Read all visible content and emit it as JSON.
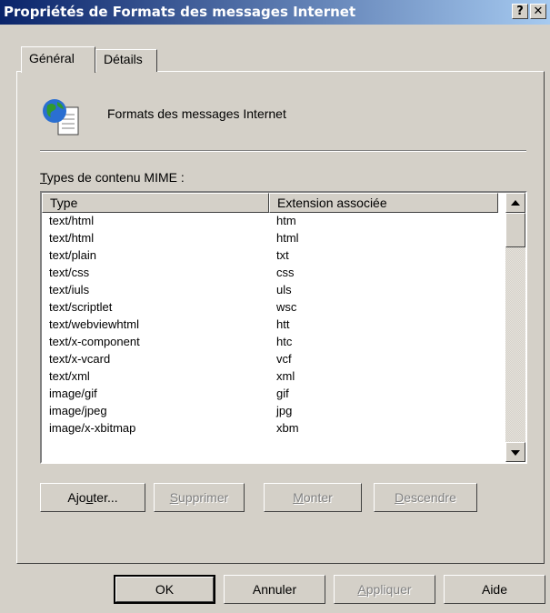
{
  "window": {
    "title": "Propriétés de Formats des messages Internet",
    "help_button": "?",
    "close_button": "✕"
  },
  "tabs": [
    {
      "label": "Général",
      "active": true
    },
    {
      "label": "Détails",
      "active": false
    }
  ],
  "header": {
    "label": "Formats des messages Internet",
    "icon": "globe-document-icon"
  },
  "mime": {
    "label_mnemonic": "T",
    "label_rest": "ypes de contenu MIME :",
    "columns": [
      "Type",
      "Extension associée"
    ],
    "rows": [
      {
        "type": "text/html",
        "ext": "htm"
      },
      {
        "type": "text/html",
        "ext": "html"
      },
      {
        "type": "text/plain",
        "ext": "txt"
      },
      {
        "type": "text/css",
        "ext": "css"
      },
      {
        "type": "text/iuls",
        "ext": "uls"
      },
      {
        "type": "text/scriptlet",
        "ext": "wsc"
      },
      {
        "type": "text/webviewhtml",
        "ext": "htt"
      },
      {
        "type": "text/x-component",
        "ext": "htc"
      },
      {
        "type": "text/x-vcard",
        "ext": "vcf"
      },
      {
        "type": "text/xml",
        "ext": "xml"
      },
      {
        "type": "image/gif",
        "ext": "gif"
      },
      {
        "type": "image/jpeg",
        "ext": "jpg"
      },
      {
        "type": "image/x-xbitmap",
        "ext": "xbm"
      }
    ]
  },
  "actions": {
    "add": {
      "pre": "Ajo",
      "mn": "u",
      "post": "ter..."
    },
    "remove": {
      "pre": "",
      "mn": "S",
      "post": "upprimer"
    },
    "up": {
      "pre": "",
      "mn": "M",
      "post": "onter"
    },
    "down": {
      "pre": "",
      "mn": "D",
      "post": "escendre"
    }
  },
  "footer": {
    "ok": "OK",
    "cancel": "Annuler",
    "apply": {
      "pre": "",
      "mn": "A",
      "post": "ppliquer"
    },
    "help": "Aide"
  }
}
